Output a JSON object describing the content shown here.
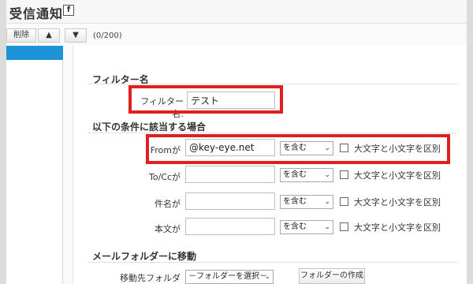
{
  "window": {
    "title": "受信通知",
    "help_icon_label": "f"
  },
  "toolbar": {
    "delete_label": "削除",
    "up_label": "▲",
    "down_label": "▼",
    "count": "(0/200)"
  },
  "sections": {
    "filter_name": {
      "heading": "フィルター名",
      "label": "フィルター名:",
      "value": "テスト"
    },
    "conditions": {
      "heading": "以下の条件に該当する場合",
      "rows": [
        {
          "label": "Fromが",
          "value": "@key-eye.net",
          "operator": "を含む",
          "checkbox_label": "大文字と小文字を区別"
        },
        {
          "label": "To/Ccが",
          "value": "",
          "operator": "を含む",
          "checkbox_label": "大文字と小文字を区別"
        },
        {
          "label": "件名が",
          "value": "",
          "operator": "を含む",
          "checkbox_label": "大文字と小文字を区別"
        },
        {
          "label": "本文が",
          "value": "",
          "operator": "を含む",
          "checkbox_label": "大文字と小文字を区別"
        }
      ]
    },
    "move": {
      "heading": "メールフォルダーに移動",
      "label": "移動先フォルダー:",
      "select_value": "－フォルダーを選択－",
      "create_button": "フォルダーの作成"
    }
  },
  "colors": {
    "accent": "#1e93d8",
    "highlight": "#e02020"
  }
}
